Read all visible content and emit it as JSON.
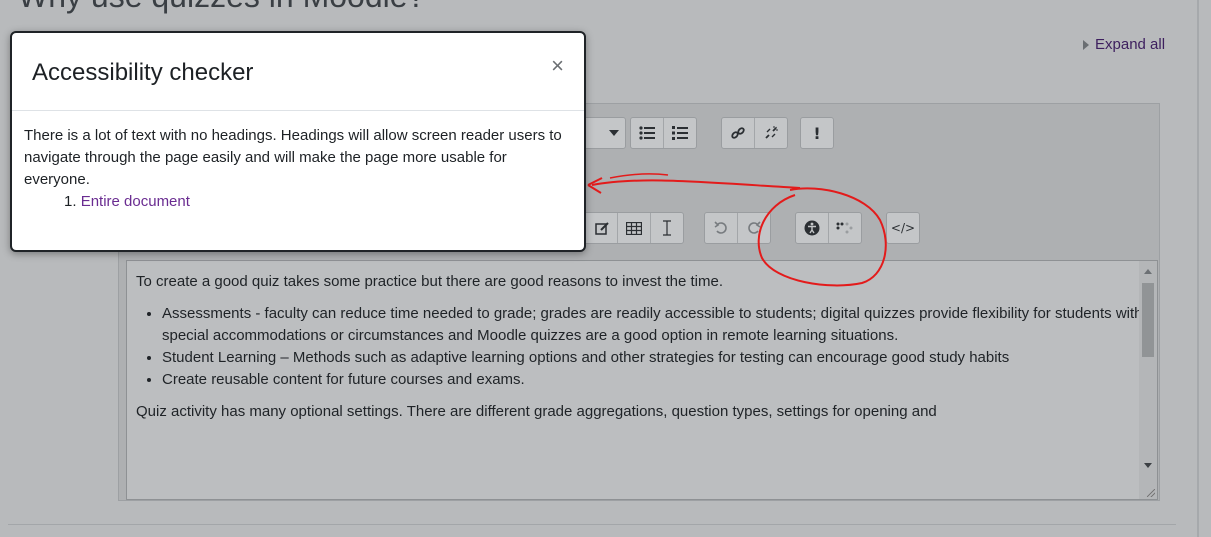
{
  "page": {
    "title": "Why use quizzes in Moodle?"
  },
  "expand_all": "Expand all",
  "modal": {
    "title": "Accessibility checker",
    "close": "×",
    "message": "There is a lot of text with no headings. Headings will allow screen reader users to navigate through the page easily and will make the page more usable for everyone.",
    "item_number": "1.",
    "item_link": "Entire document"
  },
  "content": {
    "intro": "To create a good quiz takes some practice but there are good reasons to invest the time.",
    "bullets": [
      "Assessments - faculty can reduce time needed to grade; grades are readily accessible to students; digital quizzes provide flexibility for students with special accommodations or circumstances and Moodle quizzes are a good option in remote learning situations.",
      "Student Learning – Methods such as adaptive learning options and other strategies for testing can encourage good study habits",
      "Create reusable content for future courses and exams."
    ],
    "trailing": "Quiz activity has many optional settings. There are different grade aggregations, question types, settings for opening and"
  },
  "toolbar": {
    "row1": [
      "dropdown-arrow",
      "bullet-list",
      "numbered-list",
      "link",
      "unlink",
      "special-character"
    ],
    "row2": [
      "edit-image",
      "table",
      "text-cursor",
      "undo",
      "redo",
      "accessibility-checker",
      "screenreader-helper",
      "html-source"
    ],
    "html_label": "</>"
  },
  "colors": {
    "annotation": "#e31b1b",
    "link": "#6a2c91"
  }
}
